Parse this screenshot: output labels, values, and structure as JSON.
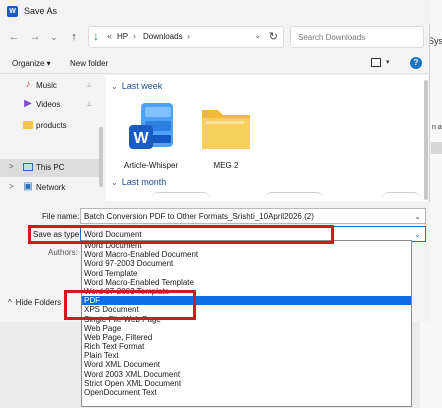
{
  "window": {
    "title": "Save As",
    "app_icon_letter": "W"
  },
  "background": {
    "sys_text": "Sys",
    "fragment": "n a"
  },
  "nav": {
    "back": "←",
    "forward": "→",
    "expand": "⌄",
    "up": "↑",
    "breadcrumb_prefix": "«",
    "crumbs": [
      "HP",
      "Downloads"
    ],
    "sep": "›",
    "addr_chevron": "⌄",
    "refresh": "↻",
    "search_placeholder": "Search Downloads"
  },
  "toolbar": {
    "organize": "Organize ▾",
    "new_folder": "New folder",
    "help": "?"
  },
  "navpane": {
    "items": [
      {
        "label": "Music",
        "icon": "music-icon",
        "pin": "📌"
      },
      {
        "label": "Videos",
        "icon": "video-icon",
        "pin": "📌"
      },
      {
        "label": "products",
        "icon": "folder-icon"
      },
      {
        "label": "This PC",
        "icon": "pc-icon",
        "expander": ">"
      },
      {
        "label": "Network",
        "icon": "network-icon",
        "expander": ">"
      }
    ]
  },
  "content": {
    "group1": {
      "caret": "⌄",
      "label": "Last week"
    },
    "group2": {
      "caret": "⌄",
      "label": "Last month"
    },
    "files": [
      {
        "name": "Article-Whisper",
        "type": "word-doc"
      },
      {
        "name": "MEG 2",
        "type": "folder"
      }
    ]
  },
  "form": {
    "file_name_label": "File name:",
    "file_name_value": "Batch Conversion PDF to Other Formats_Srishti_10April2026 (2)",
    "save_as_type_label": "Save as type:",
    "save_as_type_value": "Word Document",
    "authors_label": "Authors:",
    "hide_folders": "Hide Folders",
    "chevron": "⌄"
  },
  "dropdown": {
    "options": [
      "Word Document",
      "Word Macro-Enabled Document",
      "Word 97-2003 Document",
      "Word Template",
      "Word Macro-Enabled Template",
      "Word 97-2003 Template",
      "PDF",
      "XPS Document",
      "Single File Web Page",
      "Web Page",
      "Web Page, Filtered",
      "Rich Text Format",
      "Plain Text",
      "Word XML Document",
      "Word 2003 XML Document",
      "Strict Open XML Document",
      "OpenDocument Text"
    ],
    "selected_index": 6
  },
  "colors": {
    "accent": "#0b6ee6",
    "highlight_box": "#d8161e",
    "link": "#1f4e8c"
  }
}
